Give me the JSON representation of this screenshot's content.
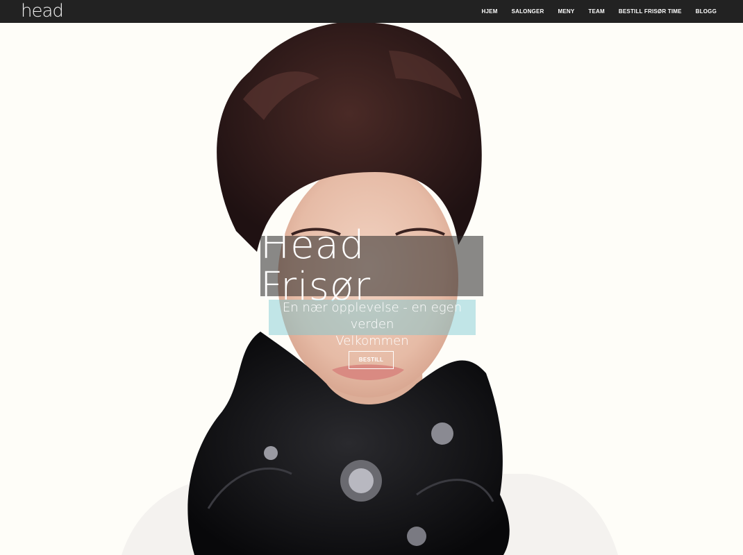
{
  "header": {
    "logo": "head",
    "nav": [
      {
        "label": "HJEM"
      },
      {
        "label": "SALONGER"
      },
      {
        "label": "MENY"
      },
      {
        "label": "TEAM"
      },
      {
        "label": "BESTILL FRISØR TIME"
      },
      {
        "label": "BLOGG"
      }
    ],
    "background": "#222222"
  },
  "hero": {
    "title": "Head Frisør",
    "tagline_line1": "En nær opplevelse - en egen verden",
    "tagline_line2": "Velkommen",
    "button_label": "BESTILL",
    "title_box_color": "rgba(40,40,40,0.55)",
    "tagline_box_color": "rgba(120,200,210,0.45)"
  }
}
